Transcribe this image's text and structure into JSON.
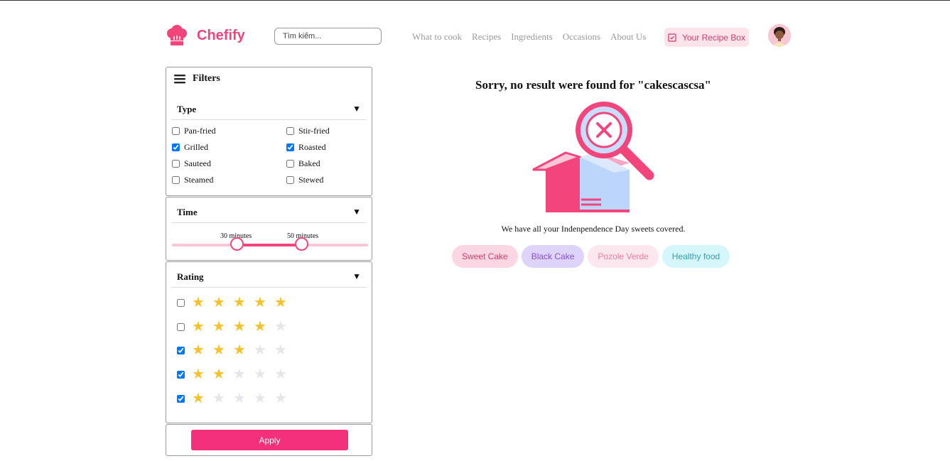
{
  "header": {
    "app_name": "Chefify",
    "search_placeholder": "Tìm kiếm...",
    "nav": [
      "What to cook",
      "Recipes",
      "Ingredients",
      "Occasions",
      "About Us"
    ],
    "recipe_box_label": "Your Recipe Box",
    "brand_color": "#f2457b"
  },
  "filters": {
    "title": "Filters",
    "type": {
      "heading": "Type",
      "options": [
        {
          "label": "Pan-fried",
          "checked": false
        },
        {
          "label": "Stir-fried",
          "checked": false
        },
        {
          "label": "Grilled",
          "checked": true
        },
        {
          "label": "Roasted",
          "checked": true
        },
        {
          "label": "Sauteed",
          "checked": false
        },
        {
          "label": "Baked",
          "checked": false
        },
        {
          "label": "Steamed",
          "checked": false
        },
        {
          "label": "Stewed",
          "checked": false
        }
      ]
    },
    "time": {
      "heading": "Time",
      "min_label": "30 minutes",
      "max_label": "50 minutes"
    },
    "rating": {
      "heading": "Rating",
      "rows": [
        {
          "stars": 5,
          "checked": false
        },
        {
          "stars": 4,
          "checked": false
        },
        {
          "stars": 3,
          "checked": true
        },
        {
          "stars": 2,
          "checked": true
        },
        {
          "stars": 1,
          "checked": true
        }
      ]
    },
    "apply_label": "Apply"
  },
  "results": {
    "title": "Sorry, no result were found for \"cakescascsa\"",
    "message": "We have all your Indenpendence Day sweets covered.",
    "tags": [
      {
        "label": "Sweet Cake",
        "bg": "#fcd6e2",
        "fg": "#d6396c"
      },
      {
        "label": "Black Cake",
        "bg": "#ddd3fb",
        "fg": "#8a4fd6"
      },
      {
        "label": "Pozole Verde",
        "bg": "#fde7ee",
        "fg": "#ef7aa1"
      },
      {
        "label": "Healthy food",
        "bg": "#d5f6fb",
        "fg": "#3a9db0"
      }
    ]
  }
}
